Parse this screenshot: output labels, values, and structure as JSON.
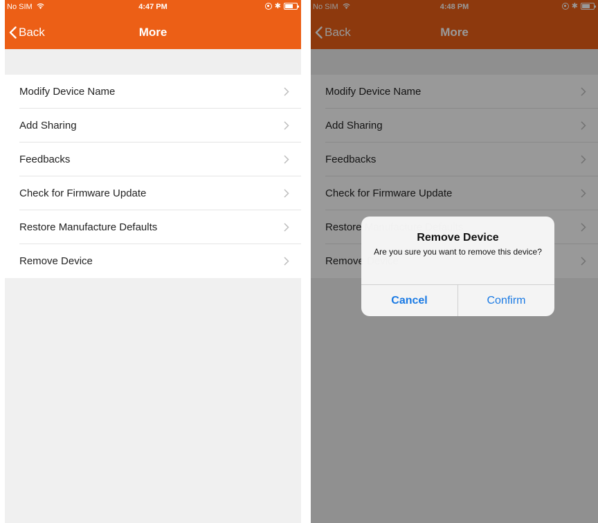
{
  "left_screen": {
    "status_bar": {
      "carrier": "No SIM",
      "time": "4:47 PM"
    },
    "nav": {
      "back_label": "Back",
      "title": "More"
    },
    "menu_items": [
      {
        "label": "Modify Device Name"
      },
      {
        "label": "Add Sharing"
      },
      {
        "label": "Feedbacks"
      },
      {
        "label": "Check for Firmware Update"
      },
      {
        "label": "Restore Manufacture Defaults"
      },
      {
        "label": "Remove Device"
      }
    ]
  },
  "right_screen": {
    "status_bar": {
      "carrier": "No SIM",
      "time": "4:48 PM"
    },
    "nav": {
      "back_label": "Back",
      "title": "More"
    },
    "menu_items": [
      {
        "label": "Modify Device Name"
      },
      {
        "label": "Add Sharing"
      },
      {
        "label": "Feedbacks"
      },
      {
        "label": "Check for Firmware Update"
      },
      {
        "label": "Restore Manufacture Defaults"
      },
      {
        "label": "Remove Device"
      }
    ],
    "dialog": {
      "title": "Remove Device",
      "message": "Are you sure you want to remove this device?",
      "cancel_label": "Cancel",
      "confirm_label": "Confirm"
    }
  },
  "colors": {
    "accent": "#ec5f16",
    "link": "#1a7ae4"
  },
  "icons": {
    "status": [
      "wifi-icon",
      "rotation-lock-icon",
      "bluetooth-icon",
      "battery-icon"
    ],
    "back": "chevron-left-icon",
    "row": "chevron-right-icon"
  }
}
